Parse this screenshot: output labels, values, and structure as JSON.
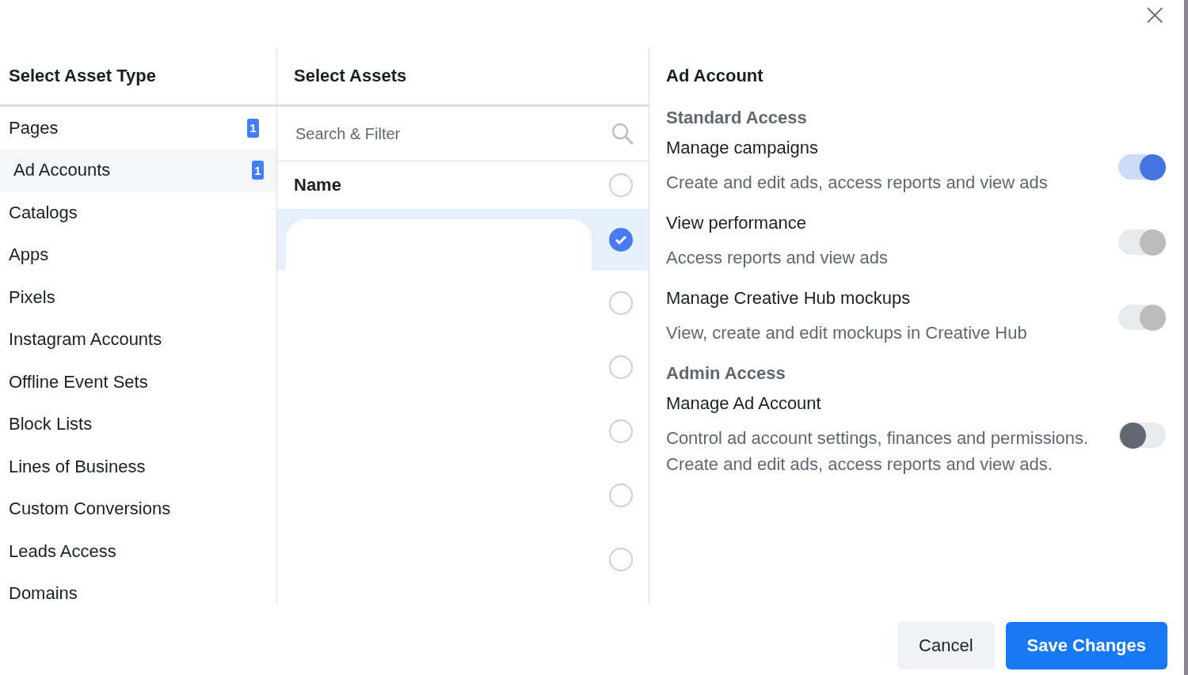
{
  "close_button": {
    "label": "×"
  },
  "asset_types": {
    "title": "Select Asset Type",
    "items": [
      {
        "label": "Pages",
        "count": "1",
        "selected": false
      },
      {
        "label": "Ad Accounts",
        "count": "1",
        "selected": true
      },
      {
        "label": "Catalogs",
        "selected": false
      },
      {
        "label": "Apps",
        "selected": false
      },
      {
        "label": "Pixels",
        "selected": false
      },
      {
        "label": "Instagram Accounts",
        "selected": false
      },
      {
        "label": "Offline Event Sets",
        "selected": false
      },
      {
        "label": "Block Lists",
        "selected": false
      },
      {
        "label": "Lines of Business",
        "selected": false
      },
      {
        "label": "Custom Conversions",
        "selected": false
      },
      {
        "label": "Leads Access",
        "selected": false
      },
      {
        "label": "Domains",
        "selected": false
      }
    ]
  },
  "assets": {
    "title": "Select Assets",
    "search": {
      "placeholder": "Search & Filter"
    },
    "name_header": "Name",
    "select_all_checked": false,
    "rows": [
      {
        "selected": true
      },
      {
        "selected": false
      },
      {
        "selected": false
      },
      {
        "selected": false
      },
      {
        "selected": false
      },
      {
        "selected": false
      }
    ]
  },
  "permissions": {
    "title": "Ad Account",
    "sections": [
      {
        "heading": "Standard Access",
        "items": [
          {
            "title": "Manage campaigns",
            "description": "Create and edit ads, access reports and view ads",
            "on": true,
            "disabled": false
          },
          {
            "title": "View performance",
            "description": "Access reports and view ads",
            "on": true,
            "disabled": true
          },
          {
            "title": "Manage Creative Hub mockups",
            "description": "View, create and edit mockups in Creative Hub",
            "on": true,
            "disabled": true
          }
        ]
      },
      {
        "heading": "Admin Access",
        "items": [
          {
            "title": "Manage Ad Account",
            "description": "Control ad account settings, finances and permissions. Create and edit ads, access reports and view ads.",
            "on": false,
            "disabled": false
          }
        ]
      }
    ]
  },
  "buttons": [
    {
      "label": "Cancel",
      "kind": "secondary"
    },
    {
      "label": "Save Changes",
      "kind": "primary"
    }
  ]
}
